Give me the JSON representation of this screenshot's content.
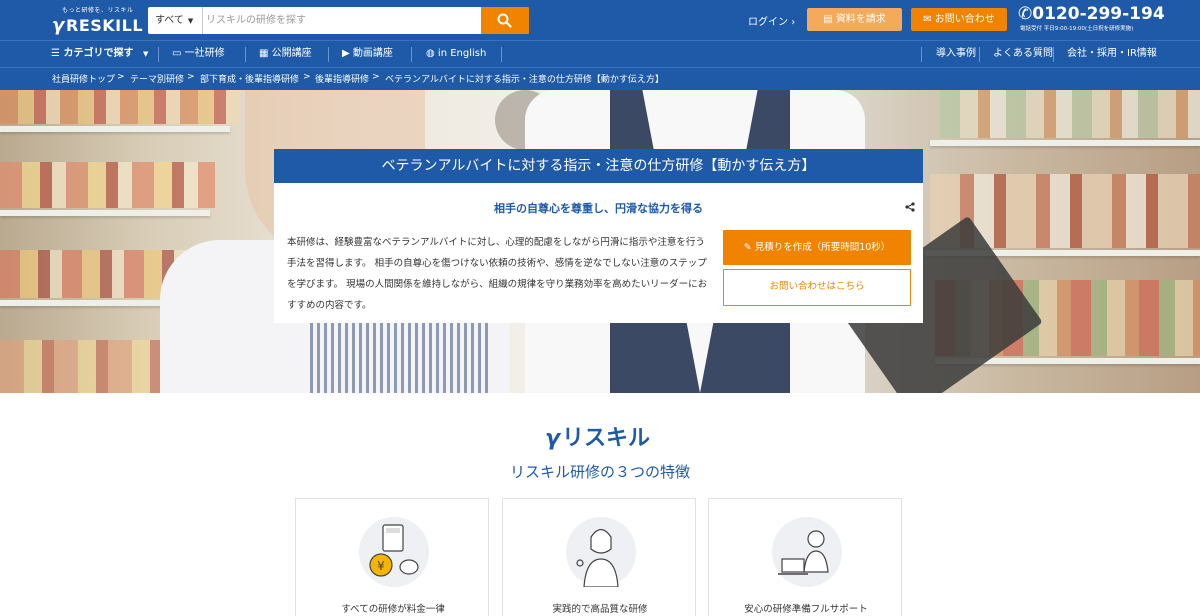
{
  "header": {
    "logo_tagline": "もっと研修を、リスキル",
    "logo_text": "RESKILL",
    "search": {
      "category": "すべて",
      "placeholder": "リスキルの研修を探す"
    },
    "login_label": "ログイン",
    "doc_request_label": "資料を請求",
    "contact_label": "お問い合わせ",
    "phone": "0120-299-194",
    "phone_hours": "電話受付 平日9:00-19:00(土日祝を研修実施)"
  },
  "nav": {
    "category_label": "カテゴリで探す",
    "left": [
      {
        "label": "一社研修",
        "icon": "presentation-icon"
      },
      {
        "label": "公開講座",
        "icon": "calendar-icon"
      },
      {
        "label": "動画講座",
        "icon": "play-icon"
      },
      {
        "label": "in English",
        "icon": "globe-icon"
      }
    ],
    "right": [
      "導入事例",
      "よくある質問",
      "会社・採用・IR情報"
    ]
  },
  "breadcrumb": [
    "社員研修トップ",
    "テーマ別研修",
    "部下育成・後輩指導研修",
    "後輩指導研修",
    "ベテランアルバイトに対する指示・注意の仕方研修【動かす伝え方】"
  ],
  "hero": {
    "title": "ベテランアルバイトに対する指示・注意の仕方研修【動かす伝え方】",
    "subtitle": "相手の自尊心を尊重し、円滑な協力を得る",
    "description": "本研修は、経験豊富なベテランアルバイトに対し、心理的配慮をしながら円滑に指示や注意を行う手法を習得します。 相手の自尊心を傷つけない依頼の技術や、感情を逆なでしない注意のステップを学びます。 現場の人間関係を維持しながら、組織の規律を守り業務効率を高めたいリーダーにおすすめの内容です。",
    "quote_button": "見積りを作成（所要時間10秒）",
    "inquiry_button": "お問い合わせはこちら"
  },
  "features": {
    "brand": "リスキル",
    "title": "リスキル研修の３つの特徴",
    "items": [
      {
        "caption": "すべての研修が料金一律",
        "icon": "calculator-coin-icon"
      },
      {
        "caption": "実践的で高品質な研修",
        "icon": "instructor-icon"
      },
      {
        "caption": "安心の研修準備フルサポート",
        "icon": "support-staff-icon"
      }
    ]
  },
  "colors": {
    "primary": "#1f5aa8",
    "accent": "#f08300",
    "accent_light": "#f5a95a"
  }
}
